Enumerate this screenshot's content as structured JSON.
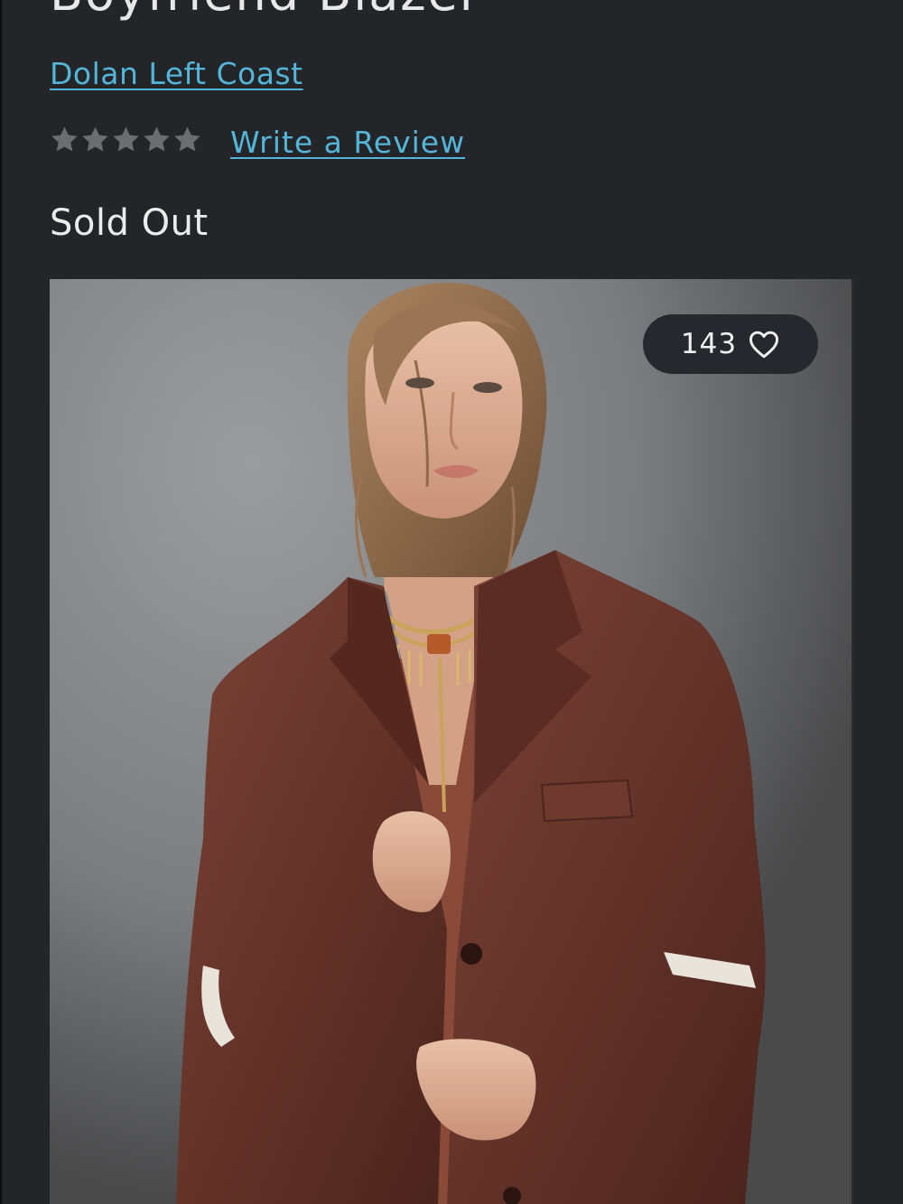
{
  "product": {
    "title": "Boyfriend Blazer",
    "brand": "Dolan Left Coast",
    "rating": {
      "stars_total": 5,
      "stars_filled": 0,
      "review_link_label": "Write a Review"
    },
    "stock_status": "Sold Out"
  },
  "image": {
    "alt": "Model wearing a brown suede boyfriend blazer",
    "favorite_count": "143",
    "favorite_icon": "heart-outline-icon"
  },
  "colors": {
    "background": "#232529",
    "link": "#54b5d8",
    "text": "#ececec",
    "star_empty": "#6c6d70",
    "pill": "#25282d",
    "blazer": "#6b3830"
  }
}
